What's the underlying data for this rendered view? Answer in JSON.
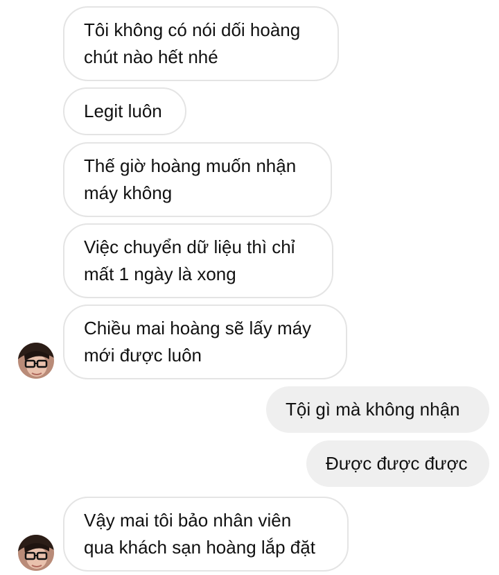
{
  "messages": [
    {
      "side": "incoming",
      "lines": [
        "Tôi không có nói dối hoàng",
        "chút nào hết nhé"
      ]
    },
    {
      "side": "incoming",
      "lines": [
        "Legit luôn"
      ]
    },
    {
      "side": "incoming",
      "lines": [
        "Thế giờ hoàng muốn nhận",
        "máy không"
      ]
    },
    {
      "side": "incoming",
      "lines": [
        "Việc chuyển dữ liệu thì chỉ",
        "mất  1 ngày là xong"
      ]
    },
    {
      "side": "incoming",
      "lines": [
        "Chiều mai hoàng sẽ lấy máy",
        "mới được luôn"
      ]
    },
    {
      "side": "outgoing",
      "lines": [
        "Tội gì mà không nhận"
      ]
    },
    {
      "side": "outgoing",
      "lines": [
        "Được được được"
      ]
    },
    {
      "side": "incoming",
      "lines": [
        "Vậy mai tôi bảo nhân viên",
        "qua khách sạn hoàng lắp đặt"
      ]
    }
  ],
  "avatar": {
    "icon": "profile-photo-icon"
  }
}
